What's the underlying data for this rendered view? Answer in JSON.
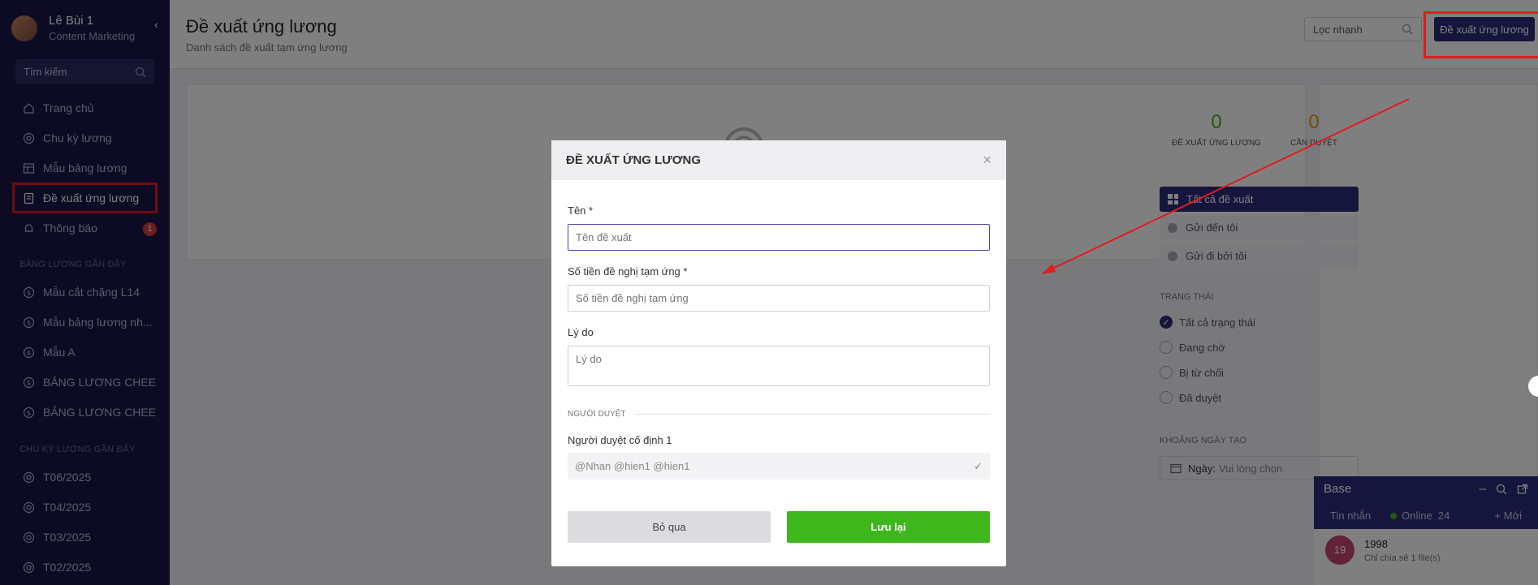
{
  "sidebar": {
    "user_name": "Lê Bùi 1",
    "user_role": "Content Marketing",
    "search_placeholder": "Tìm kiếm",
    "nav": [
      {
        "label": "Trang chủ",
        "icon": "home-icon"
      },
      {
        "label": "Chu kỳ lương",
        "icon": "cycle-icon"
      },
      {
        "label": "Mẫu bảng lương",
        "icon": "table-icon"
      },
      {
        "label": "Đề xuất ứng lương",
        "icon": "document-icon"
      },
      {
        "label": "Thông báo",
        "icon": "bell-icon",
        "badge": "1"
      }
    ],
    "recent_tables_title": "BẢNG LƯƠNG GẦN ĐÂY",
    "recent_tables": [
      "Mẫu cắt chặng L14",
      "Mẫu bảng lương nh...",
      "Mẫu A",
      "BẢNG LƯƠNG CHEE",
      "BẢNG LƯƠNG CHEE"
    ],
    "recent_cycles_title": "CHU KỲ LƯƠNG GẦN ĐÂY",
    "recent_cycles": [
      "T06/2025",
      "T04/2025",
      "T03/2025",
      "T02/2025"
    ]
  },
  "header": {
    "title": "Đề xuất ứng lương",
    "subtitle": "Danh sách đề xuất tạm ứng lương",
    "quick_filter_placeholder": "Lọc nhanh",
    "add_button": "Đề xuất ứng lương"
  },
  "stats": [
    {
      "value": "0",
      "label": "ĐỀ XUẤT ỨNG LƯƠNG",
      "color": "#3cb521"
    },
    {
      "value": "0",
      "label": "CẦN DUYỆT",
      "color": "#e2a400"
    }
  ],
  "filters": {
    "scopes": [
      "Tất cả đề xuất",
      "Gửi đến tôi",
      "Gửi đi bởi tôi"
    ],
    "status_title": "TRẠNG THÁI",
    "statuses": [
      "Tất cả trạng thái",
      "Đang chờ",
      "Bị từ chối",
      "Đã duyệt"
    ],
    "date_title": "KHOẢNG NGÀY TẠO",
    "date_label": "Ngày:",
    "date_placeholder": "Vui lòng chọn"
  },
  "chat": {
    "title": "Base",
    "tab_messages": "Tin nhắn",
    "online_label": "Online",
    "online_count": "24",
    "new_label": "+ Mới",
    "item_avatar": "19",
    "item_name": "1998",
    "item_preview": "Chỉ chia sẻ 1 file(s)"
  },
  "modal": {
    "title": "ĐỀ XUẤT ỨNG LƯƠNG",
    "name_label": "Tên *",
    "name_placeholder": "Tên đề xuất",
    "amount_label": "Số tiền đề nghị tạm ứng *",
    "amount_placeholder": "Số tiền đề nghị tạm ứng",
    "reason_label": "Lý do",
    "reason_placeholder": "Lý do",
    "approver_section": "NGƯỜI DUYỆT",
    "approver_label": "Người duyệt cố định 1",
    "approver_value": "@Nhan @hien1 @hien1",
    "skip_button": "Bỏ qua",
    "save_button": "Lưu lại"
  },
  "colors": {
    "sidebar_bg": "#1b1747",
    "primary": "#2d2a7a",
    "save_green": "#3db71c",
    "annotation_red": "#e21b1b"
  }
}
